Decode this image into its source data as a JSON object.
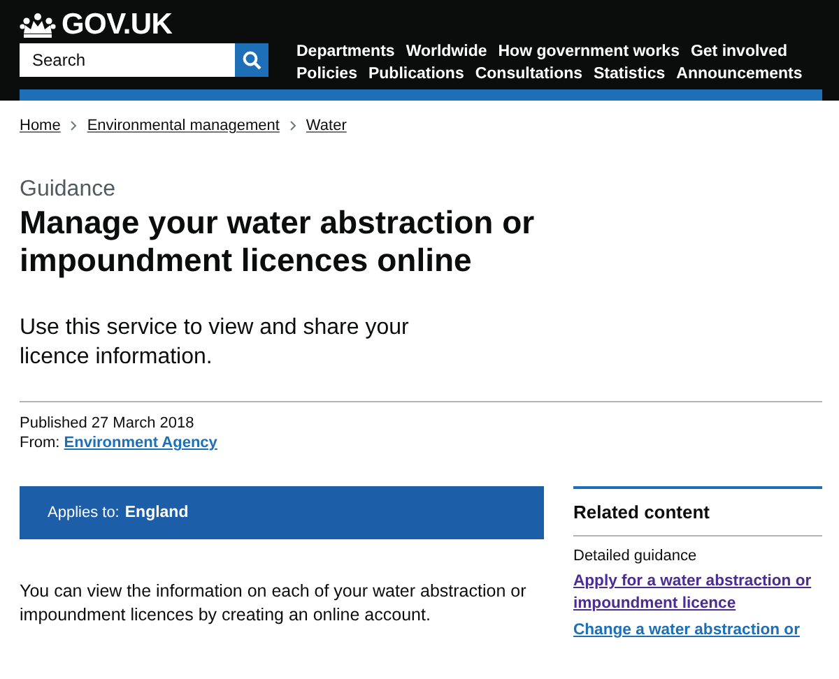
{
  "header": {
    "logo": "GOV.UK",
    "search": {
      "placeholder": "Search"
    },
    "nav": [
      [
        "Departments",
        "Worldwide",
        "How government works",
        "Get involved"
      ],
      [
        "Policies",
        "Publications",
        "Consultations",
        "Statistics",
        "Announcements"
      ]
    ]
  },
  "breadcrumbs": [
    "Home",
    "Environmental management",
    "Water"
  ],
  "page": {
    "kicker": "Guidance",
    "title": "Manage your water abstraction or impoundment licences online",
    "lead": "Use this service to view and share your licence information.",
    "published": "Published 27 March 2018",
    "from_label": "From:",
    "from_link": "Environment Agency",
    "applies_label": "Applies to:",
    "applies_value": "England",
    "body": "You can view the information on each of your water abstraction or impoundment licences by creating an online account."
  },
  "related": {
    "title": "Related content",
    "section": "Detailed guidance",
    "links": [
      {
        "text": "Apply for a water abstraction or impoundment licence",
        "visited": true
      },
      {
        "text": "Change a water abstraction or",
        "visited": false
      }
    ]
  }
}
